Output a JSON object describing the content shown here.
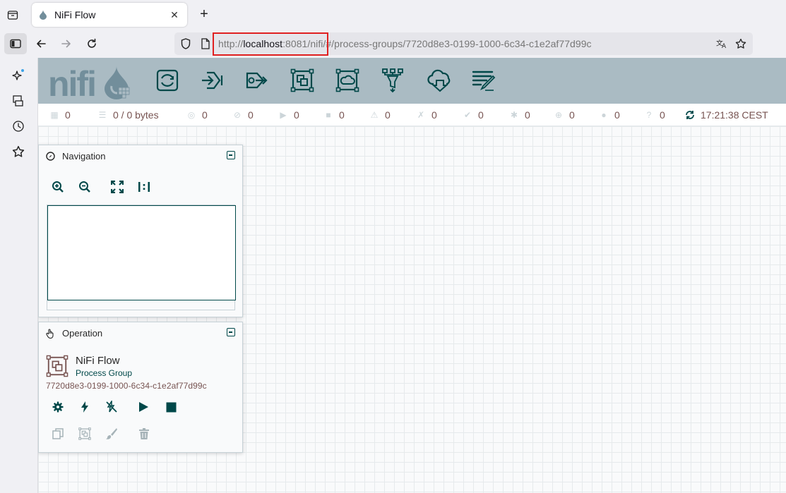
{
  "browser": {
    "tab_title": "NiFi Flow",
    "tab_close": "✕",
    "new_tab": "+",
    "url_scheme": "http://",
    "url_host": "localhost",
    "url_rest": ":8081/nifi/#/process-groups/7720d8e3-0199-1000-6c34-c1e2af77d99c"
  },
  "status": {
    "threads": "0",
    "queued": "0 / 0 bytes",
    "transmitting": "0",
    "not_transmitting": "0",
    "running": "0",
    "stopped": "0",
    "invalid": "0",
    "disabled": "0",
    "up_to_date": "0",
    "locally_modified": "0",
    "stale": "0",
    "sync_failure": "0",
    "unknown": "0",
    "refreshed": "17:21:38 CEST"
  },
  "navigation": {
    "title": "Navigation"
  },
  "operation": {
    "title": "Operation",
    "name": "NiFi Flow",
    "type": "Process Group",
    "id": "7720d8e3-0199-1000-6c34-c1e2af77d99c"
  },
  "colors": {
    "header_bg": "#aabbc3",
    "accent": "#004849",
    "status_text": "#775351",
    "url_highlight": "#e02020"
  }
}
